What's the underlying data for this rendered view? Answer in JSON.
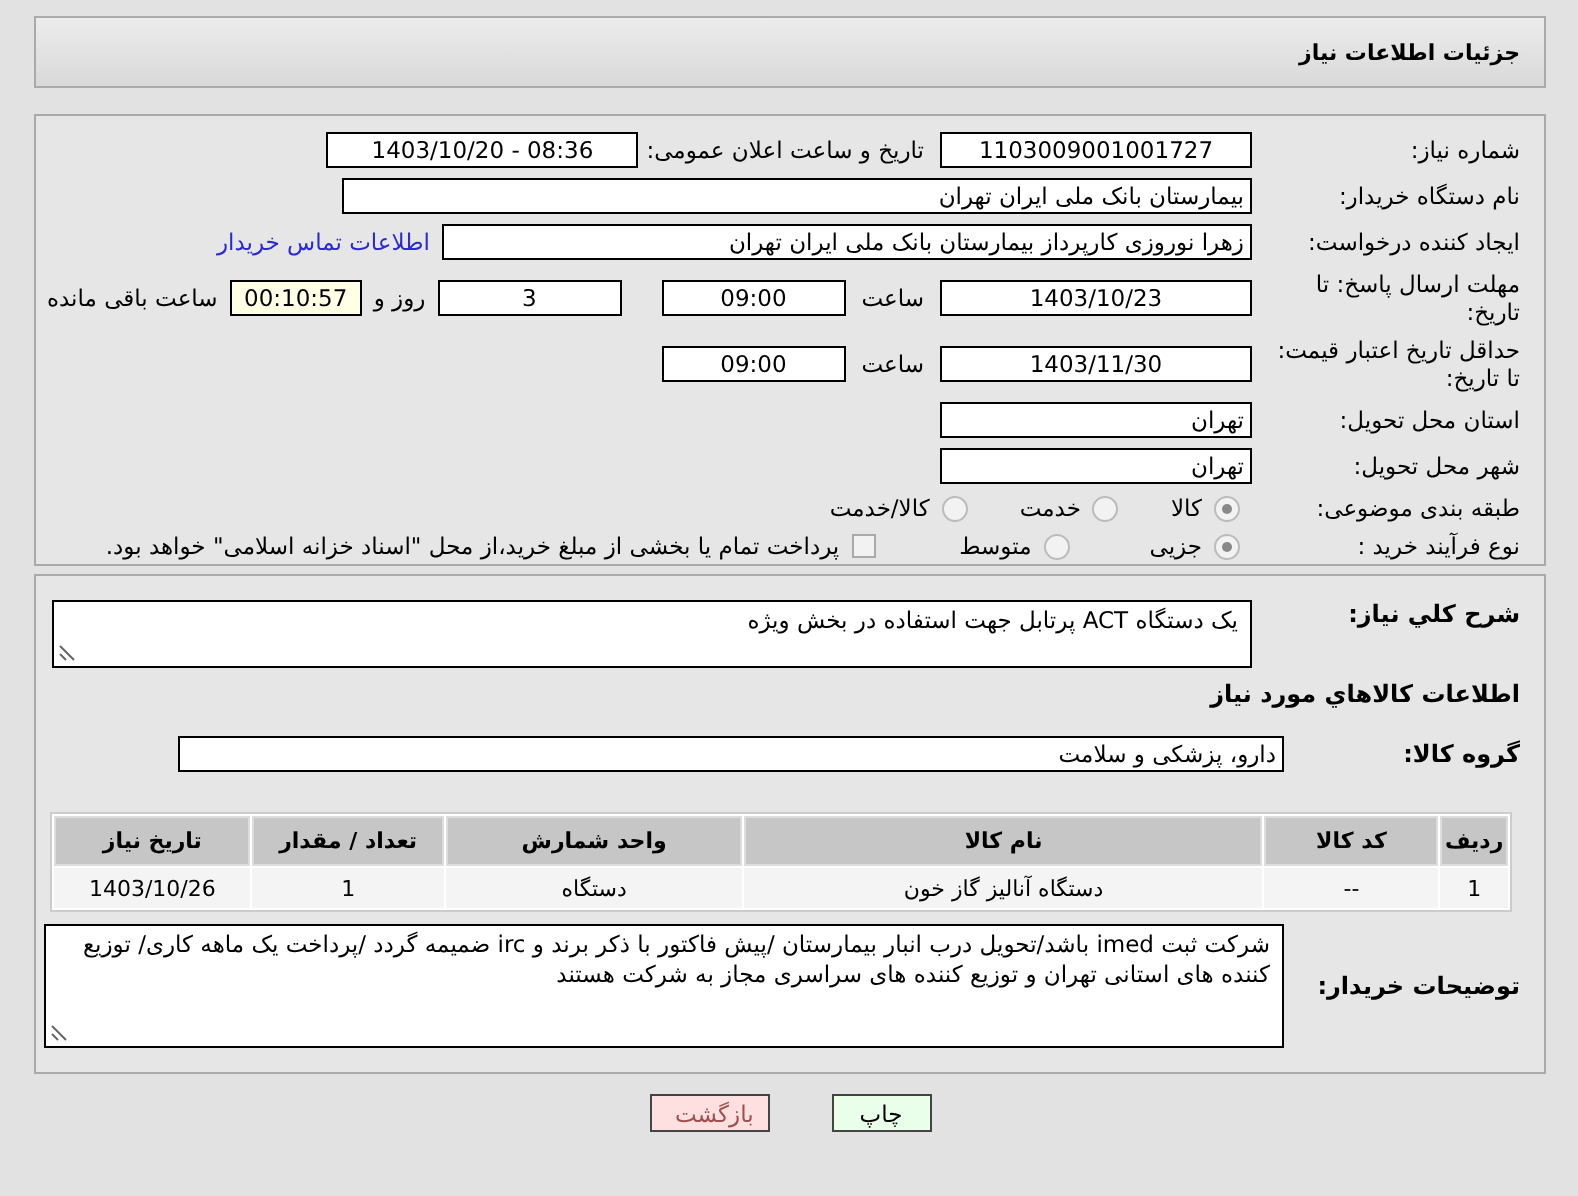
{
  "title": "جزئیات اطلاعات نیاز",
  "need_number": {
    "label": "شماره نیاز:",
    "value": "1103009001001727"
  },
  "announce": {
    "label": "تاریخ و ساعت اعلان عمومی:",
    "value": "1403/10/20 - 08:36"
  },
  "buyer_org": {
    "label": "نام دستگاه خریدار:",
    "value": "بیمارستان بانک ملی ایران تهران"
  },
  "requester": {
    "label": "ایجاد کننده درخواست:",
    "value": "زهرا نوروزی کارپرداز بیمارستان بانک ملی ایران تهران",
    "link": "اطلاعات تماس خریدار"
  },
  "reply_deadline": {
    "label": "مهلت ارسال پاسخ: تا تاریخ:",
    "date": "1403/10/23",
    "time_label": "ساعت",
    "time": "09:00",
    "days": "3",
    "days_label": "روز و",
    "remaining": "00:10:57",
    "remaining_label": "ساعت باقی مانده"
  },
  "price_validity": {
    "label": "حداقل تاریخ اعتبار قیمت: تا تاریخ:",
    "date": "1403/11/30",
    "time_label": "ساعت",
    "time": "09:00"
  },
  "province": {
    "label": "استان محل تحویل:",
    "value": "تهران"
  },
  "city": {
    "label": "شهر محل تحویل:",
    "value": "تهران"
  },
  "category": {
    "label": "طبقه بندی موضوعی:",
    "options": [
      {
        "label": "کالا",
        "selected": true
      },
      {
        "label": "خدمت",
        "selected": false
      },
      {
        "label": "کالا/خدمت",
        "selected": false
      }
    ]
  },
  "process": {
    "label": "نوع فرآیند خرید :",
    "options": [
      {
        "label": "جزیی",
        "selected": true
      },
      {
        "label": "متوسط",
        "selected": false
      }
    ],
    "checkbox": {
      "label": "پرداخت تمام یا بخشی از مبلغ خرید،از محل \"اسناد خزانه اسلامی\" خواهد بود.",
      "checked": false
    }
  },
  "description": {
    "label": "شرح كلي نياز:",
    "value": "یک دستگاه  ACT  پرتابل جهت استفاده در بخش ویژه"
  },
  "goods_heading": "اطلاعات كالاهاي مورد نياز",
  "goods_group": {
    "label": "گروه کالا:",
    "value": "دارو، پزشکی و سلامت"
  },
  "table": {
    "columns": [
      "ردیف",
      "کد کالا",
      "نام کالا",
      "واحد شمارش",
      "تعداد / مقدار",
      "تاریخ نیاز"
    ],
    "rows": [
      [
        "1",
        "--",
        "دستگاه آنالیز گاز خون",
        "دستگاه",
        "1",
        "1403/10/26"
      ]
    ]
  },
  "buyer_notes": {
    "label": "توضیحات خریدار:",
    "value": "شرکت ثبت imed باشد/تحویل درب انبار بیمارستان /پیش فاکتور با ذکر برند و irc ضمیمه گردد /پرداخت یک ماهه کاری/ توزیع کننده های استانی تهران و توزیع کننده های سراسری مجاز به شرکت هستند"
  },
  "buttons": [
    {
      "label": "چاپ",
      "kind": "print"
    },
    {
      "label": "بازگشت",
      "kind": "back"
    }
  ]
}
